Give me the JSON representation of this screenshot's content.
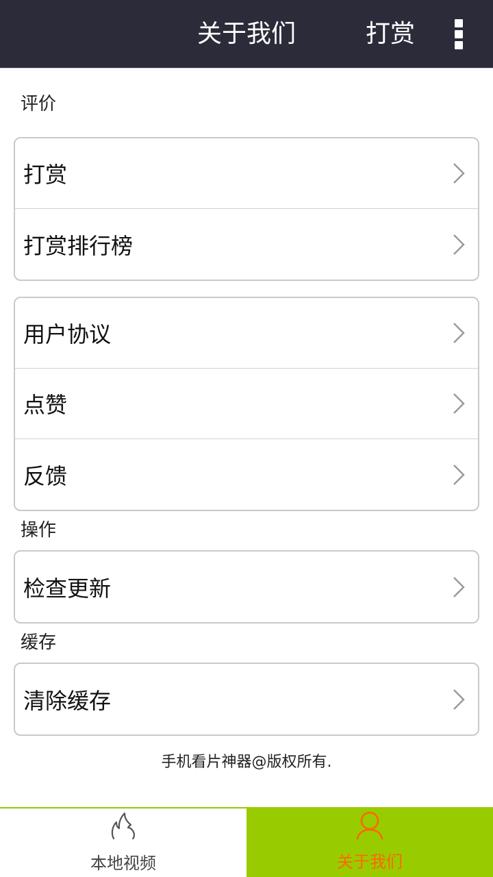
{
  "header": {
    "title": "关于我们",
    "action_label": "打赏",
    "more_icon": "more-vert-icon"
  },
  "sections": {
    "rating": "评价",
    "operations": "操作",
    "cache": "缓存"
  },
  "group1": {
    "items": [
      {
        "label": "打赏"
      },
      {
        "label": "打赏排行榜"
      }
    ]
  },
  "group2": {
    "items": [
      {
        "label": "用户协议"
      },
      {
        "label": "点赞"
      },
      {
        "label": "反馈"
      }
    ]
  },
  "group3": {
    "items": [
      {
        "label": "检查更新"
      }
    ]
  },
  "group4": {
    "items": [
      {
        "label": "清除缓存"
      }
    ]
  },
  "footer": {
    "copyright": "手机看片神器@版权所有."
  },
  "tabs": [
    {
      "label": "本地视频",
      "icon": "flame-icon"
    },
    {
      "label": "关于我们",
      "icon": "user-icon"
    }
  ],
  "colors": {
    "header_bg": "#2b2b3a",
    "tab_active_bg": "#99cc00",
    "tab_active_text": "#ff6600"
  }
}
